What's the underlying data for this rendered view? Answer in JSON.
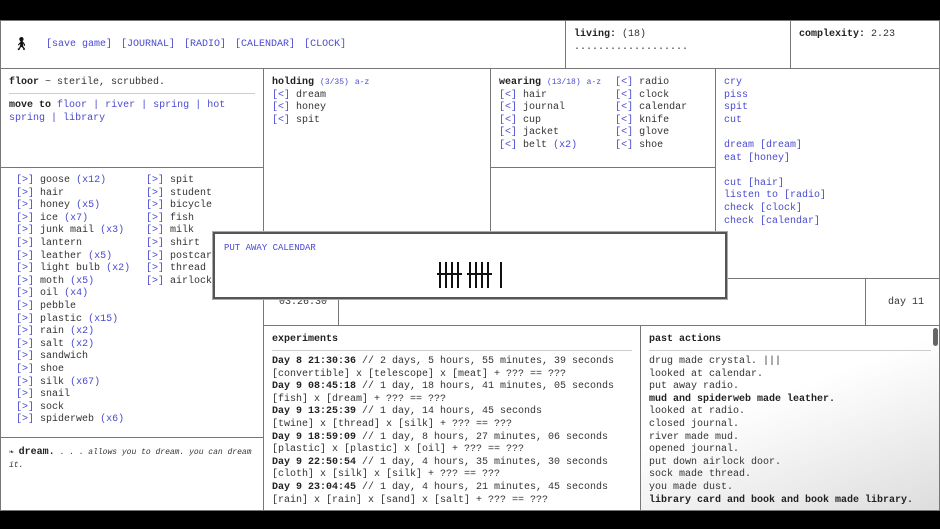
{
  "topbar": {
    "buttons": [
      "[save game]",
      "[JOURNAL]",
      "[RADIO]",
      "[CALENDAR]",
      "[CLOCK]"
    ]
  },
  "living": {
    "label": "living:",
    "count": "(18)",
    "dots": "..................."
  },
  "complexity": {
    "label": "complexity:",
    "value": "2.23"
  },
  "location": {
    "name": "floor",
    "desc": " ~ sterile, scrubbed.",
    "move_label": "move to",
    "destinations": [
      "floor",
      "river",
      "spring",
      "hot spring",
      "library"
    ]
  },
  "holding": {
    "title": "holding",
    "count": "(3/35)",
    "sort": "a-z",
    "items": [
      "dream",
      "honey",
      "spit"
    ]
  },
  "wearing": {
    "title": "wearing",
    "count": "(13/18)",
    "sort": "a-z",
    "col1": [
      {
        "n": "hair",
        "q": ""
      },
      {
        "n": "journal",
        "q": ""
      },
      {
        "n": "cup",
        "q": ""
      },
      {
        "n": "jacket",
        "q": ""
      },
      {
        "n": "belt",
        "q": "(x2)"
      }
    ],
    "col2": [
      "radio",
      "clock",
      "calendar",
      "knife",
      "glove",
      "shoe"
    ]
  },
  "actions": {
    "group1": [
      "cry",
      "piss",
      "spit",
      "cut"
    ],
    "group2": [
      "dream [dream]",
      "eat [honey]"
    ],
    "group3": [
      "cut [hair]",
      "listen to [radio]",
      "check [clock]",
      "check [calendar]"
    ]
  },
  "inventory": {
    "col1": [
      {
        "n": "goose",
        "q": "(x12)"
      },
      {
        "n": "hair",
        "q": ""
      },
      {
        "n": "honey",
        "q": "(x5)"
      },
      {
        "n": "ice",
        "q": "(x7)"
      },
      {
        "n": "junk mail",
        "q": "(x3)"
      },
      {
        "n": "lantern",
        "q": ""
      },
      {
        "n": "leather",
        "q": "(x5)"
      },
      {
        "n": "light bulb",
        "q": "(x2)"
      },
      {
        "n": "moth",
        "q": "(x5)"
      },
      {
        "n": "oil",
        "q": "(x4)"
      },
      {
        "n": "pebble",
        "q": ""
      },
      {
        "n": "plastic",
        "q": "(x15)"
      },
      {
        "n": "rain",
        "q": "(x2)"
      },
      {
        "n": "salt",
        "q": "(x2)"
      },
      {
        "n": "sandwich",
        "q": ""
      },
      {
        "n": "shoe",
        "q": ""
      },
      {
        "n": "silk",
        "q": "(x67)"
      },
      {
        "n": "snail",
        "q": ""
      },
      {
        "n": "sock",
        "q": ""
      },
      {
        "n": "spiderweb",
        "q": "(x6)"
      }
    ],
    "col2": [
      "spit",
      "student",
      "bicycle",
      "fish",
      "milk",
      "shirt",
      "postcard",
      "thread",
      "airlock d"
    ]
  },
  "description": {
    "name": "dream.",
    "dots": " . . .",
    "text": " allows you to dream. you can dream it."
  },
  "clock": {
    "time": "03:26:30"
  },
  "day": {
    "label": "day 11"
  },
  "modal": {
    "title": "PUT AWAY CALENDAR",
    "tally": "11"
  },
  "experiments": {
    "title": "experiments",
    "entries": [
      {
        "t": "Day 8 21:30:36",
        "d": " // 2 days, 5 hours, 55 minutes, 39 seconds",
        "f": "[convertible] x [telescope] x [meat] + ??? == ???"
      },
      {
        "t": "Day 9 08:45:18",
        "d": " // 1 day, 18 hours, 41 minutes, 05 seconds",
        "f": "[fish] x [dream] + ??? == ???"
      },
      {
        "t": "Day 9 13:25:39",
        "d": " // 1 day, 14 hours, 45 seconds",
        "f": "[twine] x [thread] x [silk] + ??? == ???"
      },
      {
        "t": "Day 9 18:59:09",
        "d": " // 1 day, 8 hours, 27 minutes, 06 seconds",
        "f": "[plastic] x [plastic] x [oil] + ??? == ???"
      },
      {
        "t": "Day 9 22:50:54",
        "d": " // 1 day, 4 hours, 35 minutes, 30 seconds",
        "f": "[cloth] x [silk] x [silk] + ??? == ???"
      },
      {
        "t": "Day 9 23:04:45",
        "d": " // 1 day, 4 hours, 21 minutes, 45 seconds",
        "f": "[rain] x [rain] x [sand] x [salt] + ??? == ???"
      }
    ]
  },
  "past_actions": {
    "title": "past actions",
    "items": [
      {
        "t": "drug made crystal. |||",
        "b": false
      },
      {
        "t": "looked at calendar.",
        "b": false
      },
      {
        "t": "put away radio.",
        "b": false
      },
      {
        "t": "mud and spiderweb made leather.",
        "b": true
      },
      {
        "t": "looked at radio.",
        "b": false
      },
      {
        "t": "closed journal.",
        "b": false
      },
      {
        "t": "river made mud.",
        "b": false
      },
      {
        "t": "opened journal.",
        "b": false
      },
      {
        "t": "put down airlock door.",
        "b": false
      },
      {
        "t": "sock made thread.",
        "b": false
      },
      {
        "t": "you made dust.",
        "b": false
      },
      {
        "t": "library card and book and book made library.",
        "b": true
      }
    ]
  },
  "colors": {
    "link": "#4a4ad0",
    "border": "#777777",
    "background": "#000000"
  }
}
